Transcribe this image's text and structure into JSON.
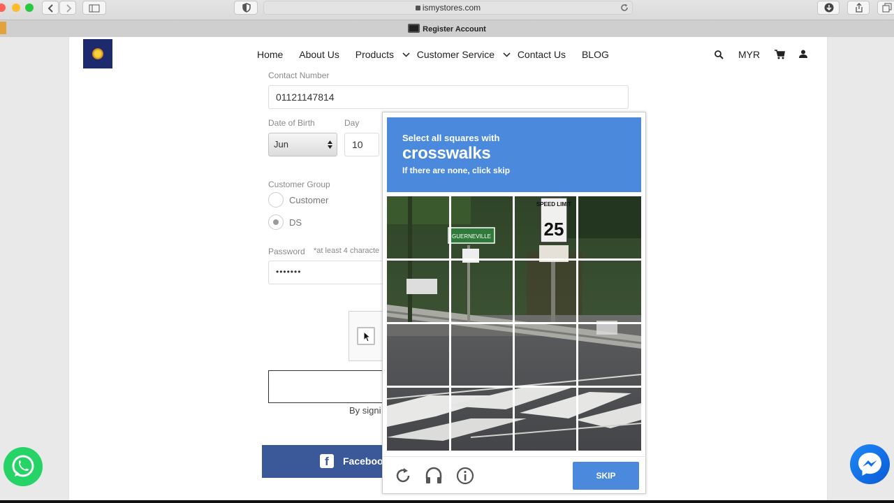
{
  "browser": {
    "url": "ismystores.com",
    "tab_title": "Register Account"
  },
  "header": {
    "nav": [
      "Home",
      "About Us",
      "Products",
      "Customer Service",
      "Contact Us",
      "BLOG"
    ],
    "currency": "MYR"
  },
  "form": {
    "contact_label": "Contact Number",
    "contact_value": "01121147814",
    "dob_label": "Date of Birth",
    "day_label": "Day",
    "month_value": "Jun",
    "day_value": "10",
    "group_label": "Customer Group",
    "group_options": [
      "Customer",
      "DS"
    ],
    "group_selected": "DS",
    "password_label": "Password",
    "password_hint": "*at least 4 characte",
    "password_value": "•••••••",
    "by_sign_text": "By signi",
    "facebook_label": "Faceboo"
  },
  "captcha": {
    "instruction": "Select all squares with",
    "target": "crosswalks",
    "subtext": "If there are none, click skip",
    "skip_label": "SKIP",
    "sign_speed_label": "SPEED LIMIT",
    "sign_speed_value": "25",
    "sign_green_text": "GUERNEVILLE"
  },
  "colors": {
    "captcha_blue": "#4a89dc",
    "facebook_blue": "#3b5998",
    "whatsapp_green": "#25d366"
  }
}
